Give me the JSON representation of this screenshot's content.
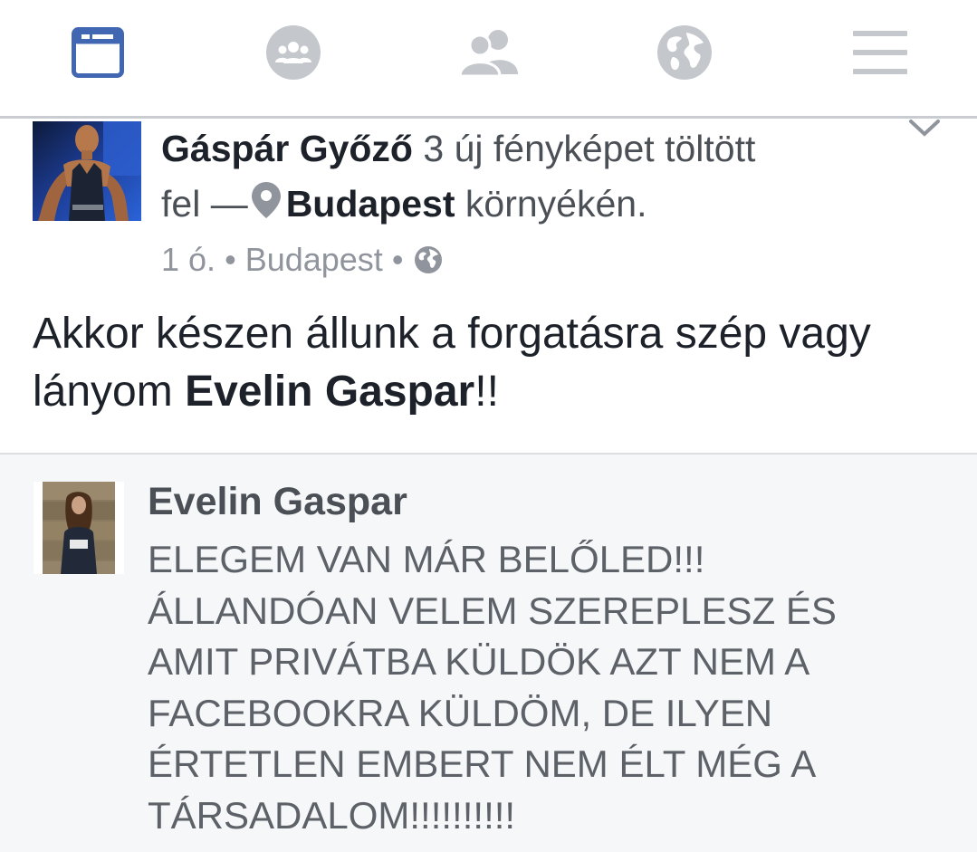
{
  "nav": {
    "items": [
      {
        "name": "news-feed",
        "icon": "news-feed-icon",
        "active": true
      },
      {
        "name": "groups",
        "icon": "groups-icon",
        "active": false
      },
      {
        "name": "friend-requests",
        "icon": "friends-icon",
        "active": false
      },
      {
        "name": "notifications",
        "icon": "globe-icon",
        "active": false
      },
      {
        "name": "menu",
        "icon": "hamburger-menu-icon",
        "active": false
      }
    ],
    "active_color": "#4267b2",
    "inactive_color": "#c4c7cc"
  },
  "post": {
    "author": "Gáspár Győző",
    "action": "3 új fényképet töltött",
    "action_cont": "fel —",
    "place": "Budapest",
    "place_suffix": "környékén.",
    "time": "1 ó.",
    "separator": "•",
    "location": "Budapest",
    "privacy_icon": "globe-icon",
    "message_part1": "Akkor készen állunk a forgatásra szép vagy lányom",
    "tagged": "Evelin Gaspar",
    "message_part2": "!!"
  },
  "comment": {
    "author": "Evelin Gaspar",
    "lines": [
      "ELEGEM VAN MÁR BELŐLED!!!",
      "ÁLLANDÓAN VELEM SZEREPLESZ ÉS",
      "AMIT PRIVÁTBA KÜLDÖK AZT NEM A",
      "FACEBOOKRA KÜLDÖM, DE ILYEN",
      "ÉRTETLEN EMBERT NEM ÉLT MÉG A",
      "TÁRSADALOM!!!!!!!!!!"
    ]
  }
}
